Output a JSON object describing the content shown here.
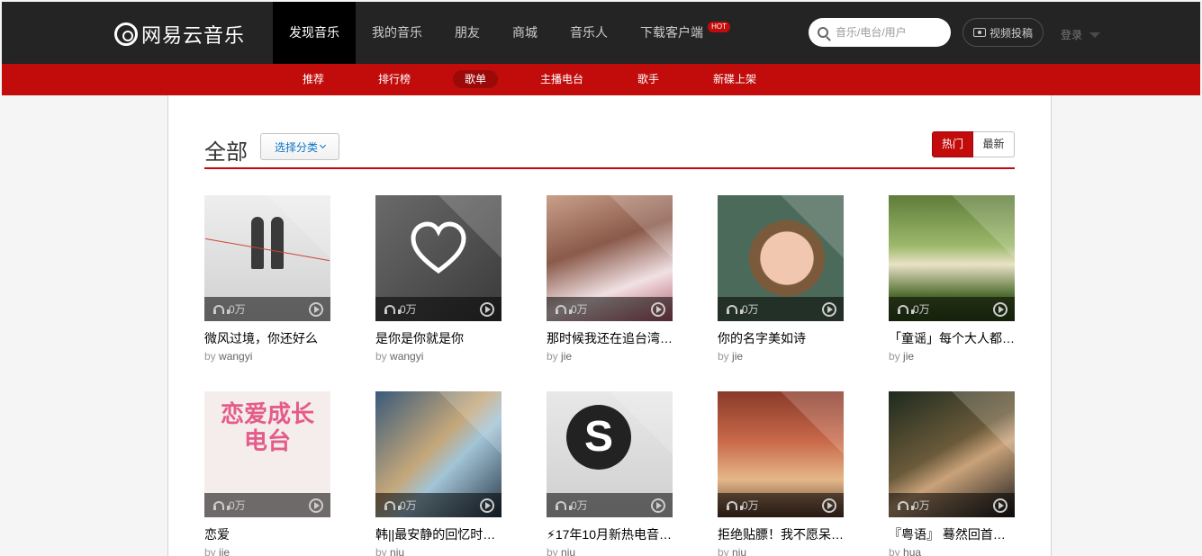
{
  "brand": {
    "name": "网易云音乐"
  },
  "topnav": [
    {
      "label": "发现音乐",
      "active": true
    },
    {
      "label": "我的音乐",
      "active": false
    },
    {
      "label": "朋友",
      "active": false
    },
    {
      "label": "商城",
      "active": false
    },
    {
      "label": "音乐人",
      "active": false
    },
    {
      "label": "下载客户端",
      "active": false,
      "badge": "HOT"
    }
  ],
  "search": {
    "placeholder": "音乐/电台/用户",
    "value": ""
  },
  "upload_label": "视频投稿",
  "login_label": "登录",
  "subnav": [
    {
      "label": "推荐",
      "active": false
    },
    {
      "label": "排行榜",
      "active": false
    },
    {
      "label": "歌单",
      "active": true
    },
    {
      "label": "主播电台",
      "active": false
    },
    {
      "label": "歌手",
      "active": false
    },
    {
      "label": "新碟上架",
      "active": false
    }
  ],
  "page": {
    "title": "全部",
    "category_button": "选择分类",
    "sort": [
      {
        "label": "热门",
        "active": true
      },
      {
        "label": "最新",
        "active": false
      }
    ]
  },
  "playlists": [
    {
      "title": "微风过境，你还好么",
      "by": "by",
      "author": "wangyi",
      "plays": "0万"
    },
    {
      "title": "是你是你就是你",
      "by": "by",
      "author": "wangyi",
      "plays": "0万"
    },
    {
      "title": "那时候我还在追台湾…",
      "by": "by",
      "author": "jie",
      "plays": "0万"
    },
    {
      "title": "你的名字美如诗",
      "by": "by",
      "author": "jie",
      "plays": "0万"
    },
    {
      "title": "「童谣」每个大人都…",
      "by": "by",
      "author": "jie",
      "plays": "0万"
    },
    {
      "title": "恋爱",
      "by": "by",
      "author": "jie",
      "plays": "0万",
      "cover_text": "恋爱成长电台"
    },
    {
      "title": "韩||最安静的回忆时…",
      "by": "by",
      "author": "niu",
      "plays": "0万"
    },
    {
      "title": "⚡17年10月新热电音…",
      "by": "by",
      "author": "niu",
      "plays": "0万"
    },
    {
      "title": "拒绝贴膘！我不愿呆…",
      "by": "by",
      "author": "niu",
      "plays": "0万"
    },
    {
      "title": "『粤语』 蓦然回首…",
      "by": "by",
      "author": "hua",
      "plays": "0万"
    }
  ],
  "colors": {
    "topbar": "#242424",
    "accent": "#c20c0c",
    "subnav_active": "#9b0909",
    "link": "#0c73c2"
  },
  "icons": {
    "search": "search-icon",
    "camera": "camera-icon",
    "headphones": "headphones-icon",
    "play": "play-icon"
  }
}
